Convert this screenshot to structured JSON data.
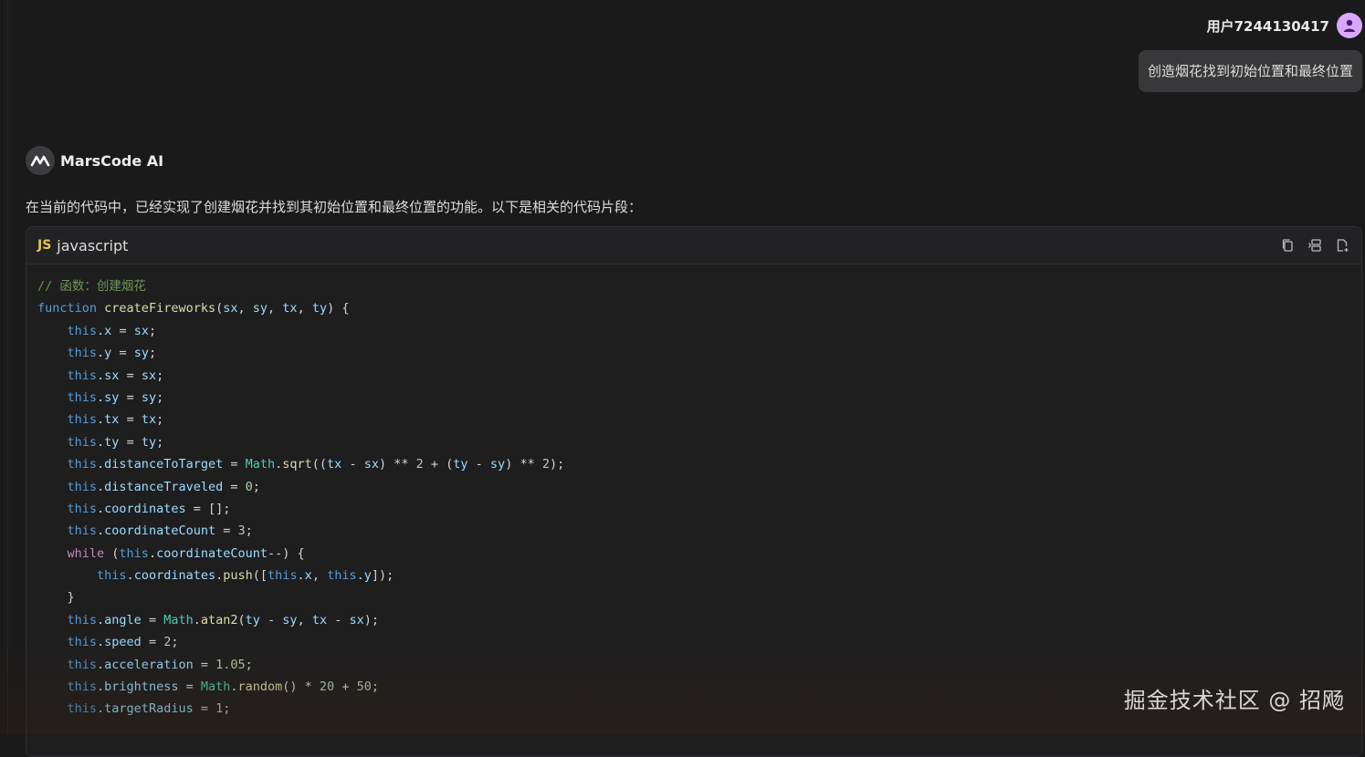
{
  "user": {
    "name": "用户7244130417",
    "message": "创造烟花找到初始位置和最终位置"
  },
  "assistant": {
    "name": "MarsCode AI",
    "intro": "在当前的代码中，已经实现了创建烟花并找到其初始位置和最终位置的功能。以下是相关的代码片段："
  },
  "code_block": {
    "lang_badge": "JS",
    "language": "javascript",
    "tools": [
      "copy-icon",
      "insert-icon",
      "new-file-icon"
    ],
    "lines": [
      [
        [
          "cm",
          "// 函数：创建烟花"
        ]
      ],
      [
        [
          "kw",
          "function"
        ],
        [
          "pl",
          " "
        ],
        [
          "fn",
          "createFireworks"
        ],
        [
          "pl",
          "("
        ],
        [
          "id",
          "sx"
        ],
        [
          "pl",
          ", "
        ],
        [
          "id",
          "sy"
        ],
        [
          "pl",
          ", "
        ],
        [
          "id",
          "tx"
        ],
        [
          "pl",
          ", "
        ],
        [
          "id",
          "ty"
        ],
        [
          "pl",
          ") {"
        ]
      ],
      [
        [
          "pl",
          "    "
        ],
        [
          "kw",
          "this"
        ],
        [
          "pl",
          "."
        ],
        [
          "id",
          "x"
        ],
        [
          "pl",
          " = "
        ],
        [
          "id",
          "sx"
        ],
        [
          "pl",
          ";"
        ]
      ],
      [
        [
          "pl",
          "    "
        ],
        [
          "kw",
          "this"
        ],
        [
          "pl",
          "."
        ],
        [
          "id",
          "y"
        ],
        [
          "pl",
          " = "
        ],
        [
          "id",
          "sy"
        ],
        [
          "pl",
          ";"
        ]
      ],
      [
        [
          "pl",
          "    "
        ],
        [
          "kw",
          "this"
        ],
        [
          "pl",
          "."
        ],
        [
          "id",
          "sx"
        ],
        [
          "pl",
          " = "
        ],
        [
          "id",
          "sx"
        ],
        [
          "pl",
          ";"
        ]
      ],
      [
        [
          "pl",
          "    "
        ],
        [
          "kw",
          "this"
        ],
        [
          "pl",
          "."
        ],
        [
          "id",
          "sy"
        ],
        [
          "pl",
          " = "
        ],
        [
          "id",
          "sy"
        ],
        [
          "pl",
          ";"
        ]
      ],
      [
        [
          "pl",
          "    "
        ],
        [
          "kw",
          "this"
        ],
        [
          "pl",
          "."
        ],
        [
          "id",
          "tx"
        ],
        [
          "pl",
          " = "
        ],
        [
          "id",
          "tx"
        ],
        [
          "pl",
          ";"
        ]
      ],
      [
        [
          "pl",
          "    "
        ],
        [
          "kw",
          "this"
        ],
        [
          "pl",
          "."
        ],
        [
          "id",
          "ty"
        ],
        [
          "pl",
          " = "
        ],
        [
          "id",
          "ty"
        ],
        [
          "pl",
          ";"
        ]
      ],
      [
        [
          "pl",
          "    "
        ],
        [
          "kw",
          "this"
        ],
        [
          "pl",
          "."
        ],
        [
          "id",
          "distanceToTarget"
        ],
        [
          "pl",
          " = "
        ],
        [
          "cls",
          "Math"
        ],
        [
          "pl",
          "."
        ],
        [
          "fn",
          "sqrt"
        ],
        [
          "pl",
          "(("
        ],
        [
          "id",
          "tx"
        ],
        [
          "pl",
          " - "
        ],
        [
          "id",
          "sx"
        ],
        [
          "pl",
          ") ** "
        ],
        [
          "num",
          "2"
        ],
        [
          "pl",
          " + ("
        ],
        [
          "id",
          "ty"
        ],
        [
          "pl",
          " - "
        ],
        [
          "id",
          "sy"
        ],
        [
          "pl",
          ") ** "
        ],
        [
          "num",
          "2"
        ],
        [
          "pl",
          ");"
        ]
      ],
      [
        [
          "pl",
          "    "
        ],
        [
          "kw",
          "this"
        ],
        [
          "pl",
          "."
        ],
        [
          "id",
          "distanceTraveled"
        ],
        [
          "pl",
          " = "
        ],
        [
          "num",
          "0"
        ],
        [
          "pl",
          ";"
        ]
      ],
      [
        [
          "pl",
          "    "
        ],
        [
          "kw",
          "this"
        ],
        [
          "pl",
          "."
        ],
        [
          "id",
          "coordinates"
        ],
        [
          "pl",
          " = [];"
        ]
      ],
      [
        [
          "pl",
          "    "
        ],
        [
          "kw",
          "this"
        ],
        [
          "pl",
          "."
        ],
        [
          "id",
          "coordinateCount"
        ],
        [
          "pl",
          " = "
        ],
        [
          "num",
          "3"
        ],
        [
          "pl",
          ";"
        ]
      ],
      [
        [
          "pl",
          "    "
        ],
        [
          "ctl",
          "while"
        ],
        [
          "pl",
          " ("
        ],
        [
          "kw",
          "this"
        ],
        [
          "pl",
          "."
        ],
        [
          "id",
          "coordinateCount"
        ],
        [
          "pl",
          "--) {"
        ]
      ],
      [
        [
          "pl",
          "        "
        ],
        [
          "kw",
          "this"
        ],
        [
          "pl",
          "."
        ],
        [
          "id",
          "coordinates"
        ],
        [
          "pl",
          "."
        ],
        [
          "fn",
          "push"
        ],
        [
          "pl",
          "(["
        ],
        [
          "kw",
          "this"
        ],
        [
          "pl",
          "."
        ],
        [
          "id",
          "x"
        ],
        [
          "pl",
          ", "
        ],
        [
          "kw",
          "this"
        ],
        [
          "pl",
          "."
        ],
        [
          "id",
          "y"
        ],
        [
          "pl",
          "]);"
        ]
      ],
      [
        [
          "pl",
          "    }"
        ]
      ],
      [
        [
          "pl",
          "    "
        ],
        [
          "kw",
          "this"
        ],
        [
          "pl",
          "."
        ],
        [
          "id",
          "angle"
        ],
        [
          "pl",
          " = "
        ],
        [
          "cls",
          "Math"
        ],
        [
          "pl",
          "."
        ],
        [
          "fn",
          "atan2"
        ],
        [
          "pl",
          "("
        ],
        [
          "id",
          "ty"
        ],
        [
          "pl",
          " - "
        ],
        [
          "id",
          "sy"
        ],
        [
          "pl",
          ", "
        ],
        [
          "id",
          "tx"
        ],
        [
          "pl",
          " - "
        ],
        [
          "id",
          "sx"
        ],
        [
          "pl",
          ");"
        ]
      ],
      [
        [
          "pl",
          "    "
        ],
        [
          "kw",
          "this"
        ],
        [
          "pl",
          "."
        ],
        [
          "id",
          "speed"
        ],
        [
          "pl",
          " = "
        ],
        [
          "num",
          "2"
        ],
        [
          "pl",
          ";"
        ]
      ],
      [
        [
          "pl",
          "    "
        ],
        [
          "kw",
          "this"
        ],
        [
          "pl",
          "."
        ],
        [
          "id",
          "acceleration"
        ],
        [
          "pl",
          " = "
        ],
        [
          "num",
          "1.05"
        ],
        [
          "pl",
          ";"
        ]
      ],
      [
        [
          "pl",
          "    "
        ],
        [
          "kw",
          "this"
        ],
        [
          "pl",
          "."
        ],
        [
          "id",
          "brightness"
        ],
        [
          "pl",
          " = "
        ],
        [
          "cls",
          "Math"
        ],
        [
          "pl",
          "."
        ],
        [
          "fn",
          "random"
        ],
        [
          "pl",
          "() * "
        ],
        [
          "num",
          "20"
        ],
        [
          "pl",
          " + "
        ],
        [
          "num",
          "50"
        ],
        [
          "pl",
          ";"
        ]
      ],
      [
        [
          "pl",
          "    "
        ],
        [
          "kw",
          "this"
        ],
        [
          "pl",
          "."
        ],
        [
          "id",
          "targetRadius"
        ],
        [
          "pl",
          " = "
        ],
        [
          "num",
          "1"
        ],
        [
          "pl",
          ";"
        ]
      ]
    ]
  },
  "watermark": "掘金技术社区 @ 招飏"
}
